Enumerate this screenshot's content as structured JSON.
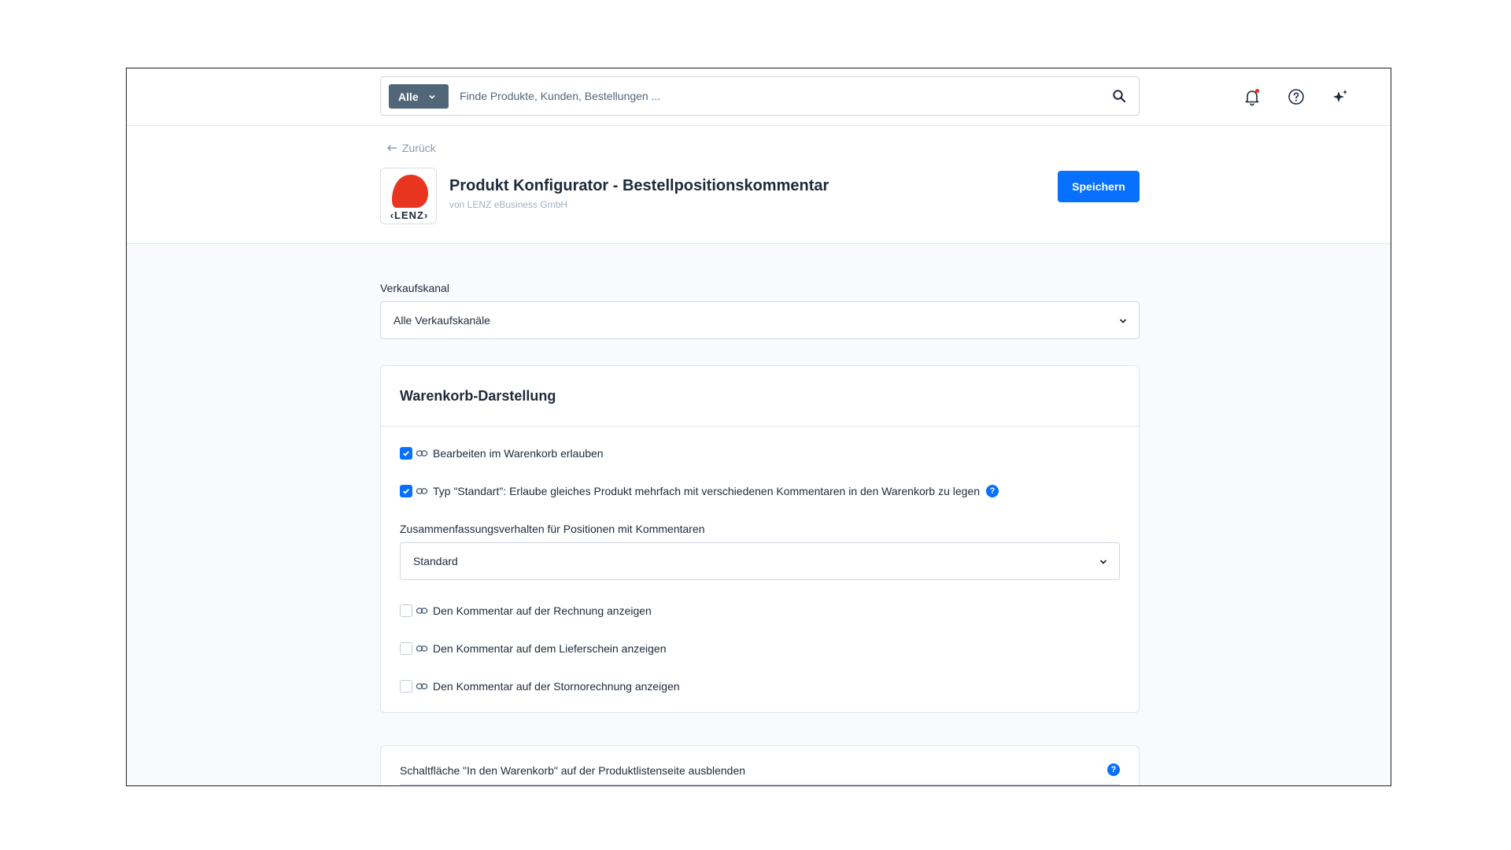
{
  "search": {
    "scope_label": "Alle",
    "placeholder": "Finde Produkte, Kunden, Bestellungen ..."
  },
  "header": {
    "back_label": "Zurück",
    "app_title": "Produkt Konfigurator - Bestellpositionskommentar",
    "vendor": "von LENZ eBusiness GmbH",
    "logo_text": "‹LENZ›",
    "save_label": "Speichern"
  },
  "sales_channel": {
    "label": "Verkaufskanal",
    "value": "Alle Verkaufskanäle"
  },
  "cart_card": {
    "title": "Warenkorb-Darstellung",
    "options": [
      {
        "label": "Bearbeiten im Warenkorb erlauben",
        "checked": true
      },
      {
        "label": "Typ \"Standart\": Erlaube gleiches Produkt mehrfach mit verschiedenen Kommentaren in den Warenkorb zu legen",
        "checked": true,
        "help": "?"
      }
    ],
    "merge_label": "Zusammenfassungsverhalten für Positionen mit Kommentaren",
    "merge_value": "Standard",
    "doc_options": [
      {
        "label": "Den Kommentar auf der Rechnung anzeigen",
        "checked": false
      },
      {
        "label": "Den Kommentar auf dem Lieferschein anzeigen",
        "checked": false
      },
      {
        "label": "Den Kommentar auf der Stornorechnung anzeigen",
        "checked": false
      }
    ]
  },
  "list_card": {
    "label": "Schaltfläche \"In den Warenkorb\" auf der Produktlistenseite ausblenden",
    "help": "?"
  },
  "colors": {
    "primary": "#0870ff",
    "scope_bg": "#52667a",
    "logo_red": "#e8351f",
    "notification_dot": "#e8351f"
  }
}
